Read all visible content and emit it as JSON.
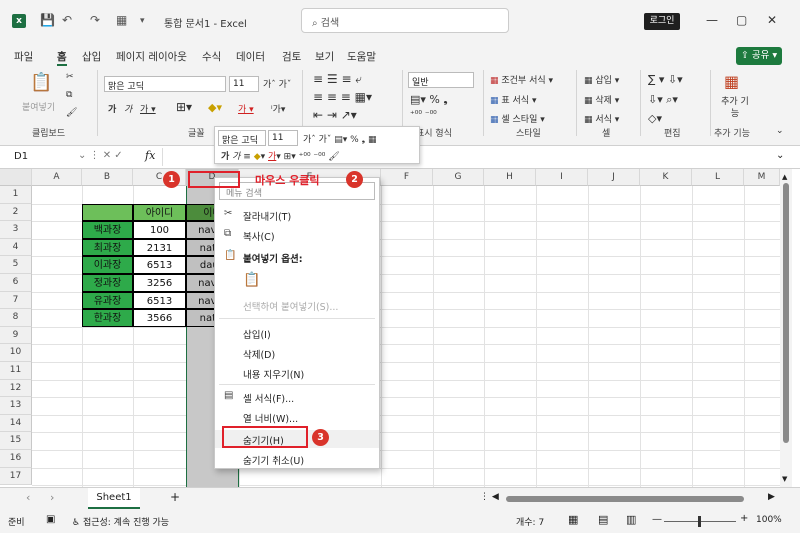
{
  "titlebar": {
    "title": "통합 문서1 - Excel",
    "search_placeholder": "검색",
    "login": "로그인",
    "minimize": "—",
    "maximize": "▢",
    "close": "✕"
  },
  "menu": {
    "items": [
      "파일",
      "홈",
      "삽입",
      "페이지 레이아웃",
      "수식",
      "데이터",
      "검토",
      "보기",
      "도움말"
    ],
    "share": "공유"
  },
  "ribbon": {
    "paste": "붙여넣기",
    "clipboard": "클립보드",
    "font_name": "맑은 고딕",
    "font_size": "11",
    "font": "글꼴",
    "number_format": "일반",
    "number_label": "표시 형식",
    "cond_format": "조건부 서식",
    "table_format": "표 서식",
    "cell_style": "셀 스타일",
    "style_label": "스타일",
    "insert": "삽입",
    "delete": "삭제",
    "format": "서식",
    "cell_label": "셀",
    "edit_label": "편집",
    "addin": "추가 기능",
    "addin_label": "추가 기능"
  },
  "formula": {
    "name_box": "D1"
  },
  "columns": [
    "A",
    "B",
    "C",
    "D",
    "E",
    "F",
    "G",
    "H",
    "I",
    "J",
    "K",
    "L",
    "M"
  ],
  "rows": [
    "1",
    "2",
    "3",
    "4",
    "5",
    "6",
    "7",
    "8",
    "9",
    "10",
    "11",
    "12",
    "13",
    "14",
    "15",
    "16",
    "17"
  ],
  "table": {
    "header_id": "아이디",
    "header_c": "이메",
    "names": [
      "백과장",
      "최과장",
      "이과장",
      "정과장",
      "유과장",
      "한과장"
    ],
    "ids": [
      "100",
      "2131",
      "6513",
      "3256",
      "6513",
      "3566"
    ],
    "emails": [
      "naver",
      "nate.",
      "daun",
      "naver",
      "naver",
      "nate."
    ]
  },
  "annotation": {
    "right_click": "마우스 우클릭",
    "b1": "1",
    "b2": "2",
    "b3": "3"
  },
  "minitoolbar": {
    "font": "맑은 고딕",
    "size": "11"
  },
  "context_menu": {
    "search": "메뉴 검색",
    "cut": "잘라내기(T)",
    "copy": "복사(C)",
    "paste_opts": "붙여넣기 옵션:",
    "paste_special": "선택하여 붙여넣기(S)...",
    "insert": "삽입(I)",
    "delete": "삭제(D)",
    "clear": "내용 지우기(N)",
    "format_cells": "셀 서식(F)...",
    "col_width": "열 너비(W)...",
    "hide": "숨기기(H)",
    "unhide": "숨기기 취소(U)"
  },
  "sheet": {
    "tab": "Sheet1",
    "add": "+"
  },
  "status": {
    "ready": "준비",
    "accessibility": "접근성: 계속 진행 가능",
    "count": "개수: 7",
    "zoom": "100%"
  }
}
